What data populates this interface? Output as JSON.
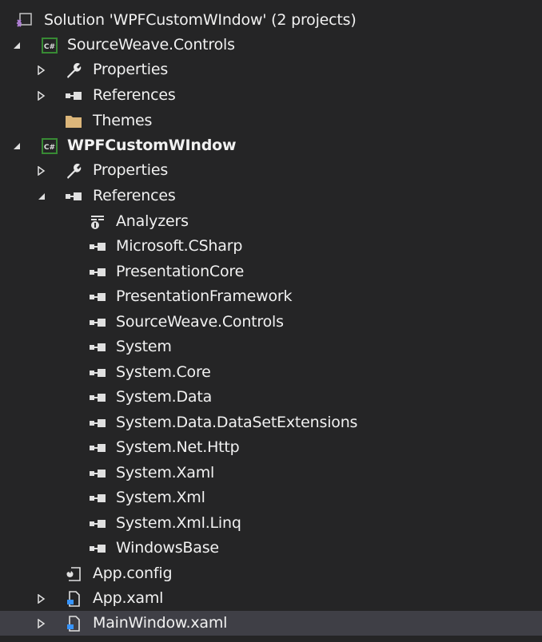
{
  "solution": {
    "label": "Solution 'WPFCustomWIndow' (2 projects)",
    "icon": "solution-icon"
  },
  "projects": [
    {
      "label": "SourceWeave.Controls",
      "icon": "csharp-project-icon",
      "expanded": true,
      "children": [
        {
          "label": "Properties",
          "icon": "wrench-icon",
          "expandable": true,
          "expanded": false
        },
        {
          "label": "References",
          "icon": "reference-icon",
          "expandable": true,
          "expanded": false
        },
        {
          "label": "Themes",
          "icon": "folder-icon",
          "expandable": false
        }
      ]
    },
    {
      "label": "WPFCustomWIndow",
      "icon": "csharp-project-icon",
      "expanded": true,
      "bold": true,
      "children": [
        {
          "label": "Properties",
          "icon": "wrench-icon",
          "expandable": true,
          "expanded": false
        },
        {
          "label": "References",
          "icon": "reference-icon",
          "expandable": true,
          "expanded": true,
          "children": [
            {
              "label": "Analyzers",
              "icon": "analyzer-icon"
            },
            {
              "label": "Microsoft.CSharp",
              "icon": "reference-icon"
            },
            {
              "label": "PresentationCore",
              "icon": "reference-icon"
            },
            {
              "label": "PresentationFramework",
              "icon": "reference-icon"
            },
            {
              "label": "SourceWeave.Controls",
              "icon": "reference-icon"
            },
            {
              "label": "System",
              "icon": "reference-icon"
            },
            {
              "label": "System.Core",
              "icon": "reference-icon"
            },
            {
              "label": "System.Data",
              "icon": "reference-icon"
            },
            {
              "label": "System.Data.DataSetExtensions",
              "icon": "reference-icon"
            },
            {
              "label": "System.Net.Http",
              "icon": "reference-icon"
            },
            {
              "label": "System.Xaml",
              "icon": "reference-icon"
            },
            {
              "label": "System.Xml",
              "icon": "reference-icon"
            },
            {
              "label": "System.Xml.Linq",
              "icon": "reference-icon"
            },
            {
              "label": "WindowsBase",
              "icon": "reference-icon"
            }
          ]
        },
        {
          "label": "App.config",
          "icon": "config-file-icon",
          "expandable": false
        },
        {
          "label": "App.xaml",
          "icon": "xaml-file-icon",
          "expandable": true,
          "expanded": false
        },
        {
          "label": "MainWindow.xaml",
          "icon": "xaml-file-icon",
          "expandable": true,
          "expanded": false,
          "selected": true
        }
      ]
    }
  ],
  "colors": {
    "background": "#252526",
    "selection": "#3f3f46",
    "text": "#f1f1f1",
    "csharp_green": "#388a34",
    "folder": "#dcb67a",
    "solution_purple": "#b180d7"
  }
}
